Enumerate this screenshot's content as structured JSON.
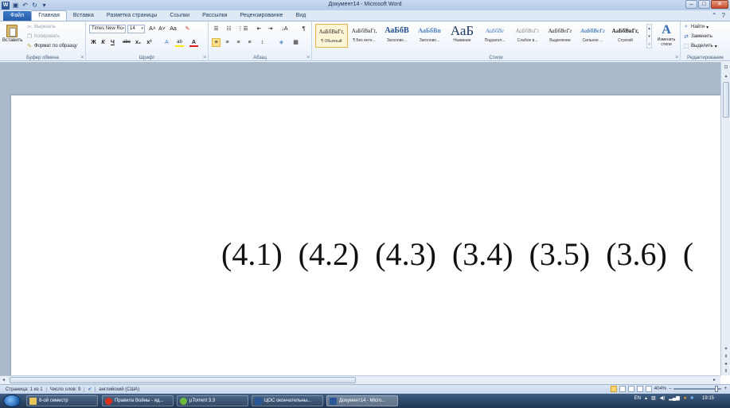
{
  "window": {
    "title": "Документ14 - Microsoft Word",
    "minimize": "–",
    "maximize": "□",
    "close": "✕"
  },
  "qat": {
    "app_icon": "W",
    "save": "▣",
    "undo": "↶",
    "redo": "↻",
    "customize": "▾"
  },
  "tabs": [
    {
      "label": "Файл"
    },
    {
      "label": "Главная"
    },
    {
      "label": "Вставка"
    },
    {
      "label": "Разметка страницы"
    },
    {
      "label": "Ссылки"
    },
    {
      "label": "Рассылки"
    },
    {
      "label": "Рецензирование"
    },
    {
      "label": "Вид"
    }
  ],
  "tab_right": {
    "help_collapse": "⌃",
    "help": "?"
  },
  "clipboard": {
    "paste": "Вставить",
    "cut": "Вырезать",
    "copy": "Копировать",
    "format_painter": "Формат по образцу",
    "group": "Буфер обмена"
  },
  "font": {
    "name": "Times New Rc",
    "size": "14",
    "grow": "A˄",
    "shrink": "A˅",
    "change_case": "Aa",
    "clear": "✎",
    "bold": "Ж",
    "italic": "К",
    "underline": "Ч",
    "strike": "abc",
    "subscript": "x₂",
    "superscript": "x²",
    "effects": "A",
    "highlight": "ab",
    "color": "A",
    "group": "Шрифт"
  },
  "paragraph": {
    "bullets": "☰",
    "numbering": "☷",
    "multilevel": "⋮☰",
    "decrease_indent": "⇤",
    "increase_indent": "⇥",
    "sort": "↓A",
    "pilcrow": "¶",
    "align_left": "≡",
    "center": "≡",
    "align_right": "≡",
    "justify": "≡",
    "line_spacing": "↕",
    "shading": "◈",
    "borders": "▦",
    "group": "Абзац"
  },
  "styles": {
    "items": [
      {
        "sample": "АаБбВвГг,",
        "name": "¶ Обычный"
      },
      {
        "sample": "АаБбВвГг,",
        "name": "¶ Без инте..."
      },
      {
        "sample": "АаБбВ",
        "name": "Заголово..."
      },
      {
        "sample": "АаБбВв",
        "name": "Заголово..."
      },
      {
        "sample": "АаБ",
        "name": "Название"
      },
      {
        "sample": "АаБбВе",
        "name": "Подзагол..."
      },
      {
        "sample": "АаБбВеГг",
        "name": "Слабое в..."
      },
      {
        "sample": "АаБбВеГг",
        "name": "Выделение"
      },
      {
        "sample": "АаБбВеГг",
        "name": "Сильное ..."
      },
      {
        "sample": "АаБбВвГг,",
        "name": "Строгий"
      }
    ],
    "change_styles": "Изменить стили",
    "change_styles_icon": "A",
    "group": "Стили"
  },
  "editing": {
    "find": "Найти",
    "replace": "Заменить",
    "select": "Выделить",
    "group": "Редактирование"
  },
  "document": {
    "equations": [
      "(4.1)",
      "(4.2)",
      "(4.3)",
      "(3.4)",
      "(3.5)",
      "(3.6)"
    ],
    "trailing": "("
  },
  "statusbar": {
    "page": "Страница: 1 из 1",
    "words": "Число слов: 9",
    "language": "английский (США)",
    "zoom": "404%",
    "zoom_out": "–",
    "zoom_in": "+"
  },
  "taskbar": {
    "items": [
      {
        "label": "8-ой семестр",
        "color": "#e8c45a"
      },
      {
        "label": "Правила Войны - яд...",
        "color": "#d9321f"
      },
      {
        "label": "µTorrent 3.3",
        "color": "#6dbb3a"
      },
      {
        "label": "ЦОС окончательны...",
        "color": "#2b5797"
      },
      {
        "label": "Документ14 - Micro...",
        "color": "#2b5797"
      }
    ],
    "lang": "EN",
    "time": "19:15"
  }
}
